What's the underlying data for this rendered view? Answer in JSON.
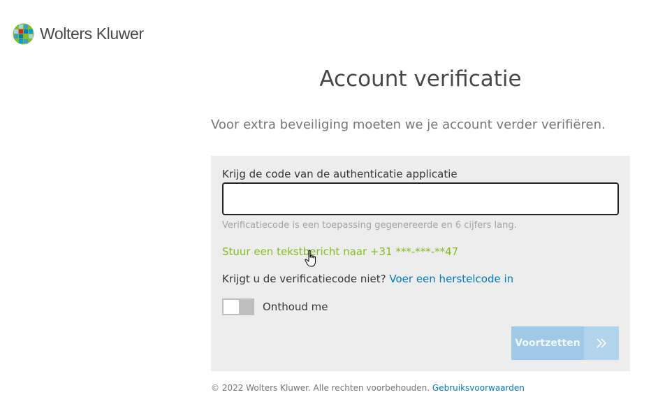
{
  "brand": {
    "name": "Wolters Kluwer",
    "logo_colors": [
      "#85bc20",
      "#007ac3",
      "#e5202e",
      "#009fda",
      "#409bd2",
      "#a6d1f0"
    ]
  },
  "page": {
    "title": "Account verificatie",
    "intro": "Voor extra beveiliging moeten we je account verder verifiëren."
  },
  "form": {
    "code_label": "Krijg de code van de authenticatie applicatie",
    "code_value": "",
    "hint": "Verificatiecode is een toepassing gegenereerde en 6 cijfers lang.",
    "sms_link": "Stuur een tekstbericht naar +31 ***-***-**47",
    "no_code_text": "Krijgt u de verificatiecode niet?",
    "recovery_link": "Voer een herstelcode in",
    "remember_label": "Onthoud me",
    "remember_checked": false,
    "continue_label": "Voortzetten",
    "continue_icon": "double-chevron-right-icon"
  },
  "footer": {
    "copyright": "© 2022 Wolters Kluwer. Alle rechten voorbehouden.",
    "terms_link": "Gebruiksvoorwaarden"
  },
  "colors": {
    "link_green": "#85bc20",
    "link_blue": "#007ac3",
    "button_disabled": "#9fc9e7",
    "panel_bg": "#ededed"
  }
}
